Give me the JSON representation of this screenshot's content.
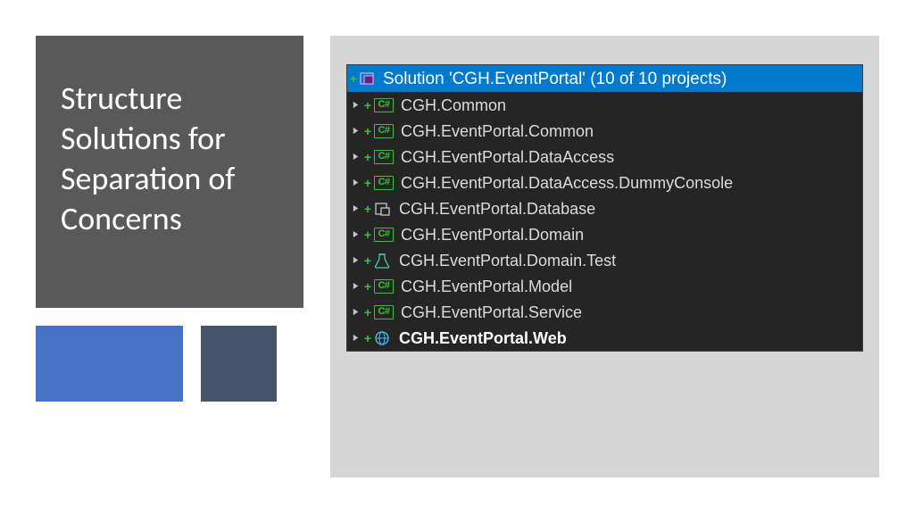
{
  "title": "Structure Solutions for Separation of Concerns",
  "solution": {
    "label": "Solution 'CGH.EventPortal' (10 of 10 projects)"
  },
  "projects": [
    {
      "name": "CGH.Common",
      "icon": "cs",
      "bold": false
    },
    {
      "name": "CGH.EventPortal.Common",
      "icon": "cs",
      "bold": false
    },
    {
      "name": "CGH.EventPortal.DataAccess",
      "icon": "cs",
      "bold": false
    },
    {
      "name": "CGH.EventPortal.DataAccess.DummyConsole",
      "icon": "cs",
      "bold": false
    },
    {
      "name": "CGH.EventPortal.Database",
      "icon": "db",
      "bold": false
    },
    {
      "name": "CGH.EventPortal.Domain",
      "icon": "cs",
      "bold": false
    },
    {
      "name": "CGH.EventPortal.Domain.Test",
      "icon": "test",
      "bold": false
    },
    {
      "name": "CGH.EventPortal.Model",
      "icon": "cs",
      "bold": false
    },
    {
      "name": "CGH.EventPortal.Service",
      "icon": "cs",
      "bold": false
    },
    {
      "name": "CGH.EventPortal.Web",
      "icon": "web",
      "bold": true
    }
  ],
  "icons": {
    "cs_label": "C#"
  }
}
